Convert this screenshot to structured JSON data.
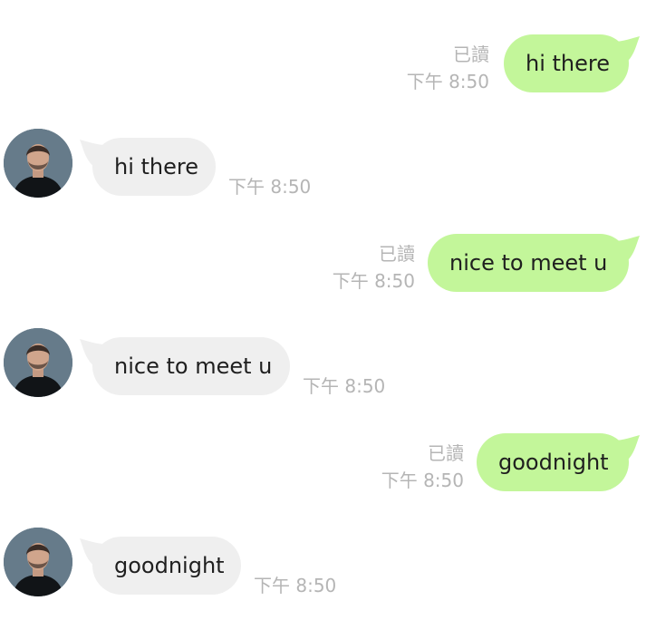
{
  "messages": [
    {
      "side": "sent",
      "text": "hi there",
      "read_label": "已讀",
      "time": "下午 8:50"
    },
    {
      "side": "received",
      "text": "hi there",
      "time": "下午 8:50"
    },
    {
      "side": "sent",
      "text": "nice to meet u",
      "read_label": "已讀",
      "time": "下午 8:50"
    },
    {
      "side": "received",
      "text": "nice to meet u",
      "time": "下午 8:50"
    },
    {
      "side": "sent",
      "text": "goodnight",
      "read_label": "已讀",
      "time": "下午 8:50"
    },
    {
      "side": "received",
      "text": "goodnight",
      "time": "下午 8:50"
    }
  ],
  "colors": {
    "sent_bubble": "#c3f69a",
    "received_bubble": "#efefef",
    "meta_text": "#b5b5b5",
    "message_text": "#1f1f1f"
  },
  "icons": {
    "avatar": "contact-avatar-photo"
  }
}
